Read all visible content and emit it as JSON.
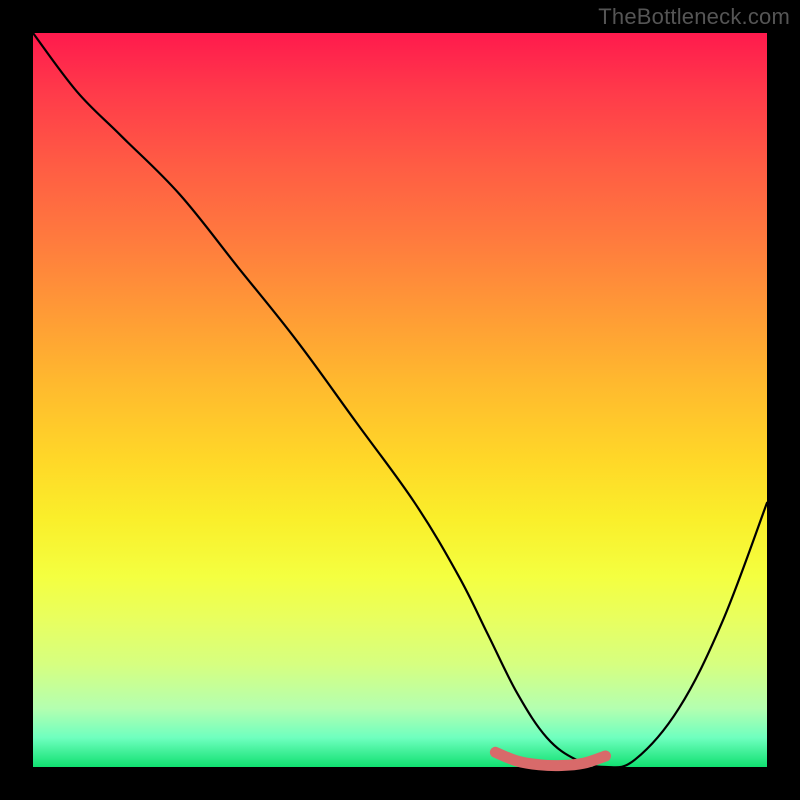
{
  "watermark": "TheBottleneck.com",
  "chart_data": {
    "type": "line",
    "title": "",
    "xlabel": "",
    "ylabel": "",
    "xlim": [
      0,
      100
    ],
    "ylim": [
      0,
      100
    ],
    "series": [
      {
        "name": "bottleneck-curve",
        "x": [
          0,
          6,
          12,
          20,
          28,
          36,
          44,
          52,
          58,
          62,
          66,
          70,
          74,
          78,
          82,
          88,
          94,
          100
        ],
        "values": [
          100,
          92,
          86,
          78,
          68,
          58,
          47,
          36,
          26,
          18,
          10,
          4,
          1,
          0,
          1,
          8,
          20,
          36
        ]
      },
      {
        "name": "highlight-segment",
        "x": [
          63,
          66,
          69,
          72,
          75,
          78
        ],
        "values": [
          2,
          0.8,
          0.3,
          0.2,
          0.5,
          1.5
        ]
      }
    ],
    "colors": {
      "curve": "#000000",
      "highlight": "#d86a6a",
      "gradient_top": "#ff1a4d",
      "gradient_bottom": "#10e070",
      "background": "#000000"
    }
  }
}
